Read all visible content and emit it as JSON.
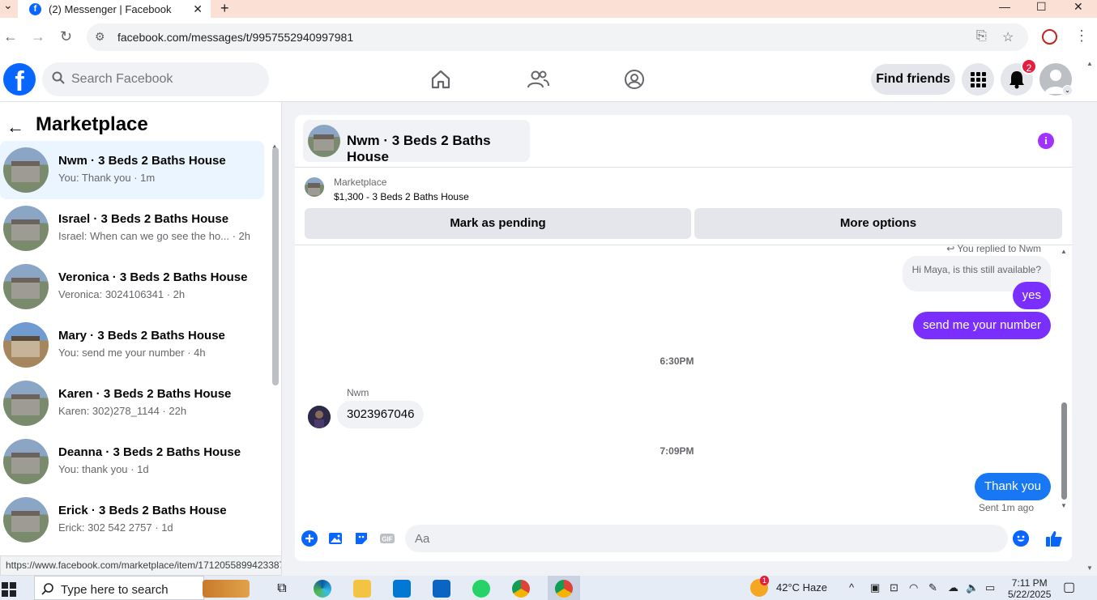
{
  "browser": {
    "tab_title": "(2) Messenger | Facebook",
    "url": "facebook.com/messages/t/9957552940997981",
    "status_url": "https://www.facebook.com/marketplace/item/1712055899423387/?referralSurfac..."
  },
  "header": {
    "search_placeholder": "Search Facebook",
    "find_friends": "Find friends",
    "notification_count": "2",
    "logo_letter": "f"
  },
  "left": {
    "title": "Marketplace",
    "conversations": [
      {
        "name": "Nwm · 3 Beds 2 Baths House",
        "snippet": "You: Thank you · 1m"
      },
      {
        "name": "Israel · 3 Beds 2 Baths House",
        "snippet": "Israel: When can we go see the ho... · 2h"
      },
      {
        "name": "Veronica · 3 Beds 2 Baths House",
        "snippet": "Veronica: 3024106341 · 2h"
      },
      {
        "name": "Mary · 3 Beds 2 Baths House",
        "snippet": "You: send me your number · 4h"
      },
      {
        "name": "Karen · 3 Beds 2 Baths House",
        "snippet": "Karen: 302)278_1144 · 22h"
      },
      {
        "name": "Deanna · 3 Beds 2 Baths House",
        "snippet": "You: thank you · 1d"
      },
      {
        "name": "Erick · 3 Beds 2 Baths House",
        "snippet": "Erick: 302 542 2757 · 1d"
      }
    ]
  },
  "chat": {
    "title": "Nwm · 3 Beds 2 Baths House",
    "listing_source": "Marketplace",
    "listing_price": "$1,300 - 3 Beds 2 Baths House",
    "mark_pending": "Mark as pending",
    "more_options": "More options",
    "replied_to": "You replied to Nwm",
    "quoted": "Hi Maya, is this still available?",
    "msg_yes": "yes",
    "msg_number": "send me your number",
    "time1": "6:30PM",
    "sender_name": "Nwm",
    "msg_phone": "3023967046",
    "time2": "7:09PM",
    "msg_thanks": "Thank you",
    "sent_status": "Sent 1m ago",
    "composer_placeholder": "Aa"
  },
  "taskbar": {
    "search_text": "Type here to search",
    "weather": "42°C  Haze",
    "time": "7:11 PM",
    "date": "5/22/2025",
    "weather_badge": "1"
  },
  "colors": {
    "fb_blue": "#0866ff",
    "purple_bubble": "#7b2fff",
    "blue_bubble": "#1877f2",
    "notification_red": "#e41e3f"
  }
}
